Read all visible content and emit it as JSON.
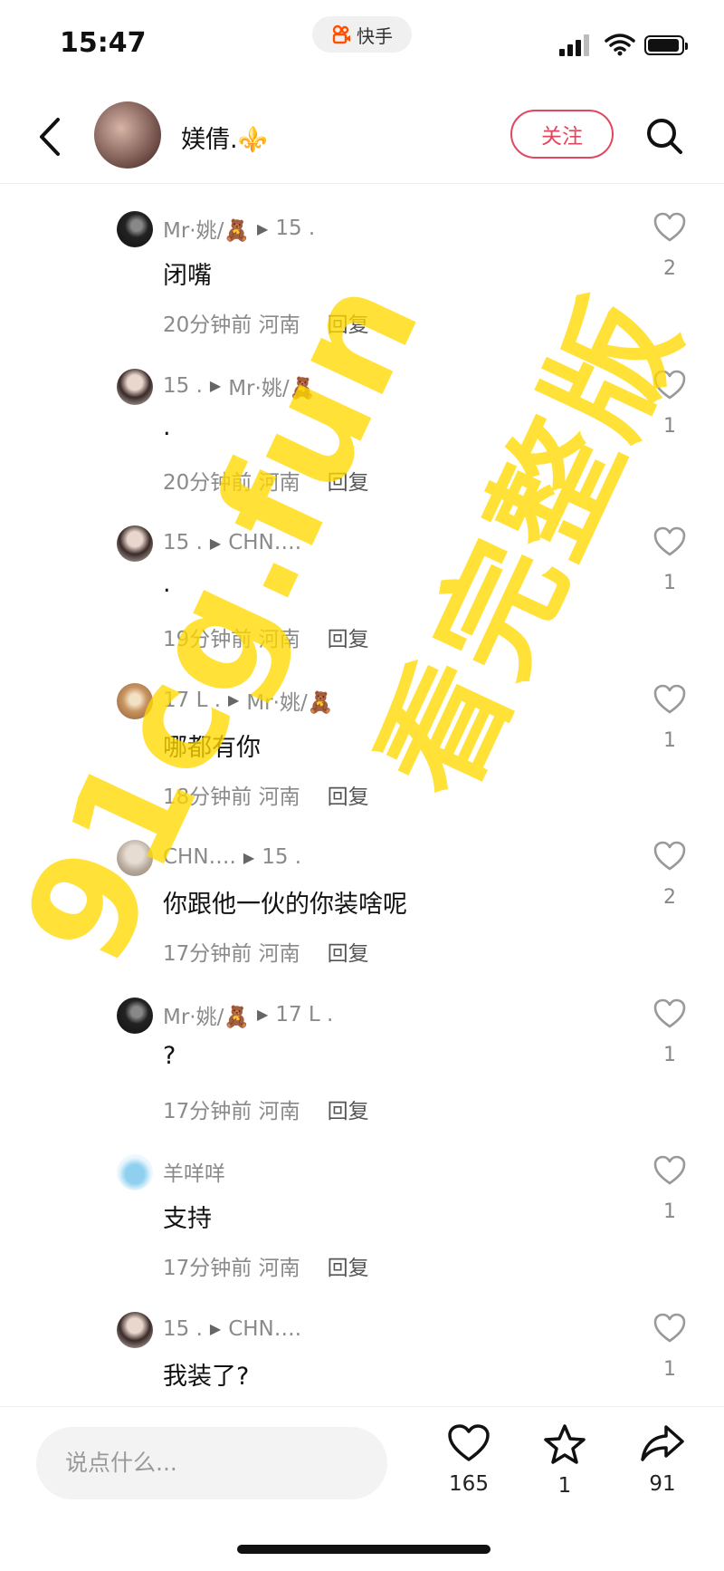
{
  "status_bar": {
    "time": "15:47",
    "app": "快手"
  },
  "header": {
    "username": "媄倩.⚜️",
    "follow_label": "关注"
  },
  "comments": [
    {
      "user": "Mr·姚/🧸",
      "reply_to": "15 .",
      "text": "闭嘴",
      "time": "20分钟前",
      "location": "河南",
      "reply_label": "回复",
      "likes": "2",
      "avatar": "dark"
    },
    {
      "user": "15 .",
      "reply_to": "Mr·姚/🧸",
      "text": ".",
      "time": "20分钟前",
      "location": "河南",
      "reply_label": "回复",
      "likes": "1",
      "avatar": "girl"
    },
    {
      "user": "15 .",
      "reply_to": "CHN….",
      "text": ".",
      "time": "19分钟前",
      "location": "河南",
      "reply_label": "回复",
      "likes": "1",
      "avatar": "girl"
    },
    {
      "user": "17 L .",
      "reply_to": "Mr·姚/🧸",
      "text": "哪都有你",
      "time": "18分钟前",
      "location": "河南",
      "reply_label": "回复",
      "likes": "1",
      "avatar": "dog"
    },
    {
      "user": "CHN….",
      "reply_to": "15 .",
      "text": "你跟他一伙的你装啥呢",
      "time": "17分钟前",
      "location": "河南",
      "reply_label": "回复",
      "likes": "2",
      "avatar": "light"
    },
    {
      "user": "Mr·姚/🧸",
      "reply_to": "17 L .",
      "text": "?",
      "time": "17分钟前",
      "location": "河南",
      "reply_label": "回复",
      "likes": "1",
      "avatar": "dark"
    },
    {
      "user": "羊咩咩",
      "reply_to": "",
      "text": "支持",
      "time": "17分钟前",
      "location": "河南",
      "reply_label": "回复",
      "likes": "1",
      "avatar": "whale"
    },
    {
      "user": "15 .",
      "reply_to": "CHN….",
      "text": "我装了?",
      "time": "",
      "location": "",
      "reply_label": "",
      "likes": "1",
      "avatar": "girl"
    }
  ],
  "bottom_bar": {
    "input_placeholder": "说点什么...",
    "likes": "165",
    "favorites": "1",
    "shares": "91"
  },
  "watermarks": [
    "91cg.fun",
    "看完整版"
  ],
  "colors": {
    "accent": "#e1475e",
    "watermark": "#ffd800"
  }
}
